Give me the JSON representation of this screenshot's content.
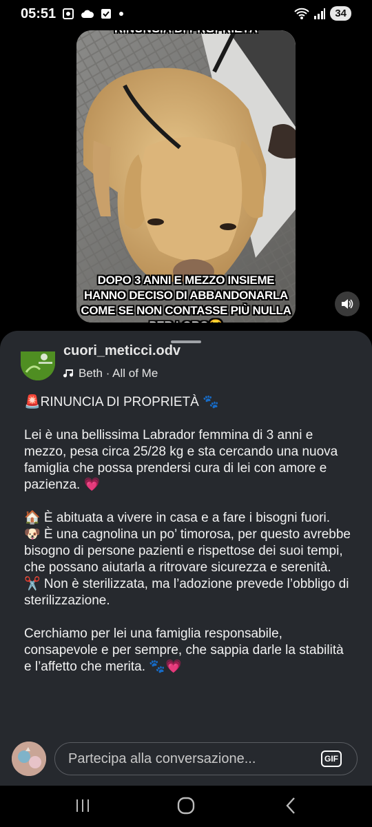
{
  "status": {
    "time": "05:51",
    "battery": "34"
  },
  "video": {
    "caption_top": "RINUNCIA DI PROPRIETÀ",
    "caption": "DOPO 3 ANNI E MEZZO INSIEME HANNO DECISO DI ABBANDONARLA COME SE NON CONTASSE PIÙ NULLA PER LORO😭"
  },
  "post": {
    "author": "cuori_meticci.odv",
    "audio": "Beth · All of Me",
    "text": "🚨RINUNCIA DI PROPRIETÀ 🐾\n\nLei è una bellissima Labrador femmina di 3 anni e mezzo, pesa circa 25/28 kg e sta cercando una nuova famiglia che possa prendersi cura di lei con amore e pazienza. 💗\n\n🏠 È abituata a vivere in casa e a fare i bisogni fuori.\n🐶 È una cagnolina un po’ timorosa, per questo avrebbe bisogno di persone pazienti e rispettose dei suoi tempi, che possano aiutarla a ritrovare sicurezza e serenità.\n✂️ Non è sterilizzata, ma l’adozione prevede l’obbligo di sterilizzazione.\n\nCerchiamo per lei una famiglia responsabile, consapevole e per sempre, che sappia darle la stabilità e l’affetto che merita. 🐾💗"
  },
  "comment": {
    "placeholder": "Partecipa alla conversazione...",
    "gif_label": "GIF"
  }
}
